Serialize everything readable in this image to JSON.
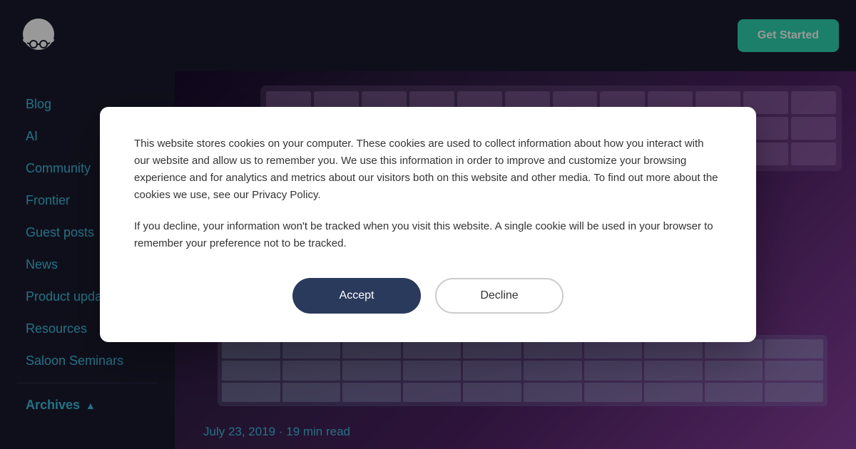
{
  "header": {
    "logo_text": "O",
    "get_started_label": "Get Started"
  },
  "sidebar": {
    "items": [
      {
        "label": "Blog",
        "active": false
      },
      {
        "label": "AI",
        "active": false
      },
      {
        "label": "Community",
        "active": false
      },
      {
        "label": "Frontier",
        "active": false
      },
      {
        "label": "Guest posts",
        "active": false
      },
      {
        "label": "News",
        "active": false
      },
      {
        "label": "Product updates",
        "active": false
      },
      {
        "label": "Resources",
        "active": false
      },
      {
        "label": "Saloon Seminars",
        "active": false
      }
    ],
    "archives_label": "Archives",
    "archives_icon": "▲"
  },
  "hero": {
    "post_meta": "July 23, 2019 · 19 min read"
  },
  "cookie_modal": {
    "text1": "This website stores cookies on your computer. These cookies are used to collect information about how you interact with our website and allow us to remember you. We use this information in order to improve and customize your browsing experience and for analytics and metrics about our visitors both on this website and other media. To find out more about the cookies we use, see our Privacy Policy.",
    "text2": "If you decline, your information won't be tracked when you visit this website. A single cookie will be used in your browser to remember your preference not to be tracked.",
    "accept_label": "Accept",
    "decline_label": "Decline"
  }
}
